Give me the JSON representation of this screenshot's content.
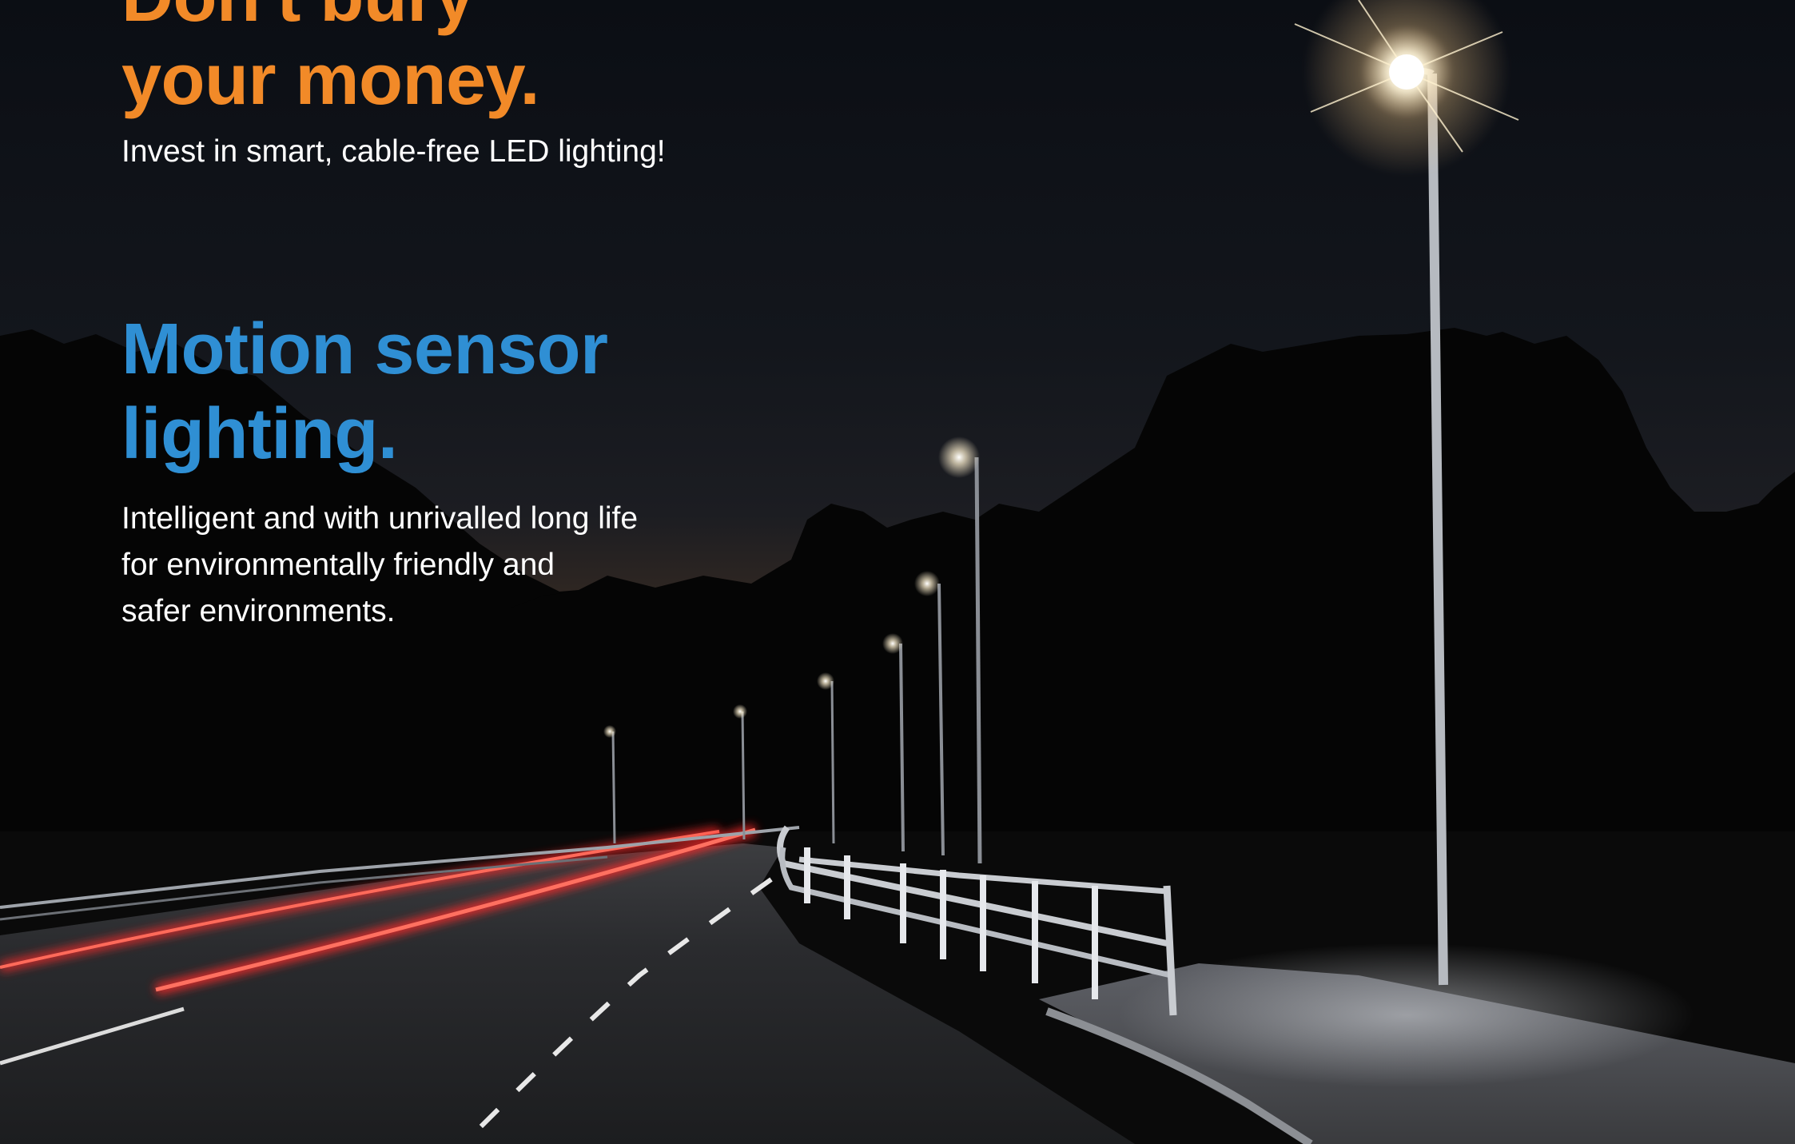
{
  "headline": {
    "line1": "Don't bury",
    "line2": "your money.",
    "color": "#f28a28"
  },
  "subheadline": "Invest in smart, cable-free LED lighting!",
  "feature": {
    "title_line1": "Motion sensor",
    "title_line2": "lighting.",
    "color": "#2f8fd4",
    "body_lines": [
      "Intelligent and with unrivalled long life",
      "for environmentally friendly and",
      "safer environments."
    ]
  },
  "scene": {
    "sky_top_color": "#0b0e14",
    "horizon_glow_color": "#9a5a22",
    "light_trail_color": "#ff2a2a",
    "lamp_light_color": "#fff6e0"
  }
}
